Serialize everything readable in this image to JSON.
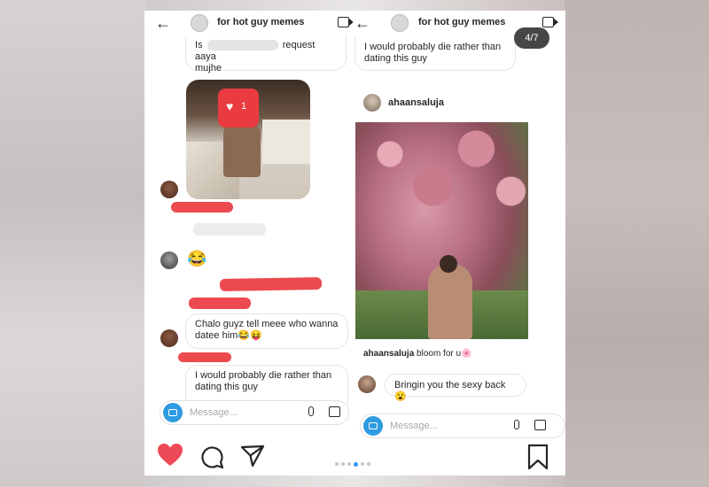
{
  "counter": "4/7",
  "left": {
    "header_title": "for hot guy memes",
    "msg1_prefix": "Is",
    "msg1_mid": "request aaya",
    "msg1_line2": "mujhe",
    "heart_count": "1",
    "laugh_emoji": "😂",
    "msg_chalo_line1": "Chalo guyz tell meee who wanna",
    "msg_chalo_line2": "datee him😂😝",
    "msg_die_line1": "I would probably die rather than",
    "msg_die_line2": "dating this guy",
    "compose_placeholder": "Message..."
  },
  "right": {
    "header_title": "for hot guy memes",
    "msg_die_line1": "I would probably die rather than",
    "msg_die_line2": "dating this guy",
    "shared_username": "ahaansaluja",
    "caption_user": "ahaansaluja",
    "caption_text": "bloom for u🌸",
    "reply": "Bringin you the sexy back😮",
    "compose_placeholder": "Message..."
  },
  "colors": {
    "like": "#ed4956",
    "accent": "#3897f0",
    "redaction": "#ea3b40"
  },
  "icons": [
    "back-arrow-icon",
    "video-call-icon",
    "camera-icon",
    "mic-icon",
    "gallery-icon",
    "heart-icon",
    "comment-icon",
    "share-icon",
    "bookmark-icon"
  ]
}
